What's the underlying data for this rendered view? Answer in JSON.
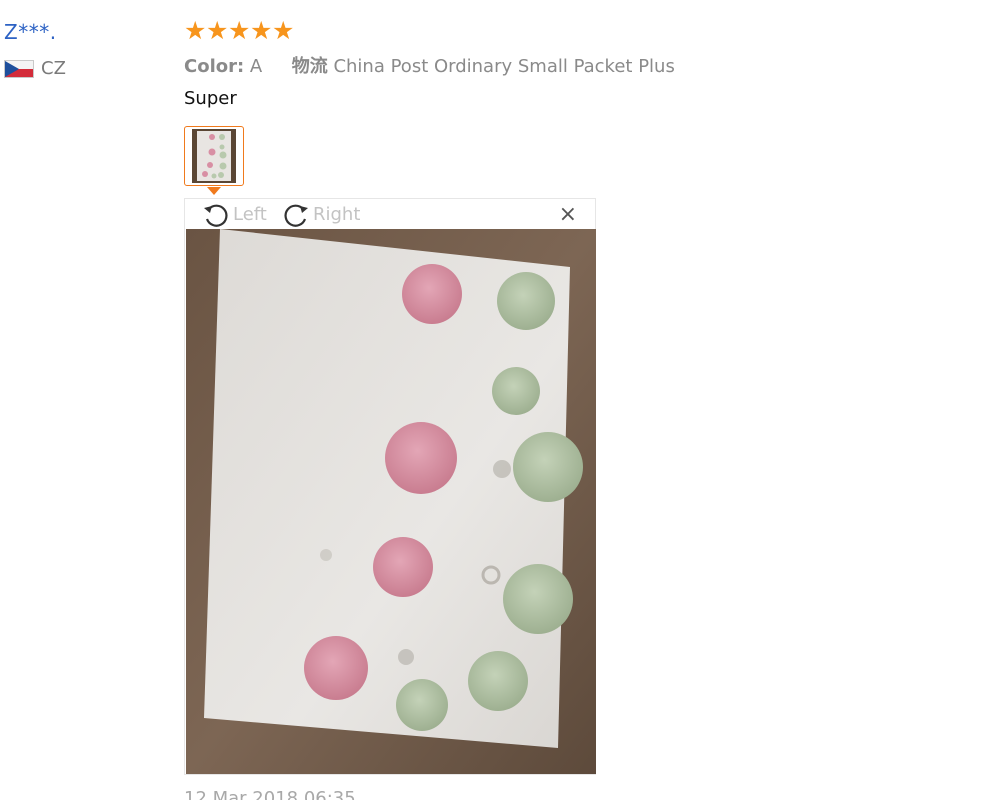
{
  "review": {
    "user_name": "Z***.",
    "country_code": "CZ",
    "rating": 5,
    "stars": [
      "★",
      "★",
      "★",
      "★",
      "★"
    ],
    "color_label": "Color:",
    "color_value": "A",
    "logistics_label": "物流",
    "logistics_value": "China Post Ordinary Small Packet Plus",
    "text": "Super",
    "date": "12 Mar 2018 06:35"
  },
  "viewer": {
    "rotate_left_label": "Left",
    "rotate_right_label": "Right",
    "close_symbol": "×"
  },
  "colors": {
    "user_link": "#2d62c4",
    "star": "#f7951d",
    "accent": "#f07a1d",
    "meta_text": "#8a8a8a"
  },
  "icons": {
    "rotate_left": "rotate-left-icon",
    "rotate_right": "rotate-right-icon",
    "close": "close-icon",
    "flag": "czech-flag-icon"
  }
}
